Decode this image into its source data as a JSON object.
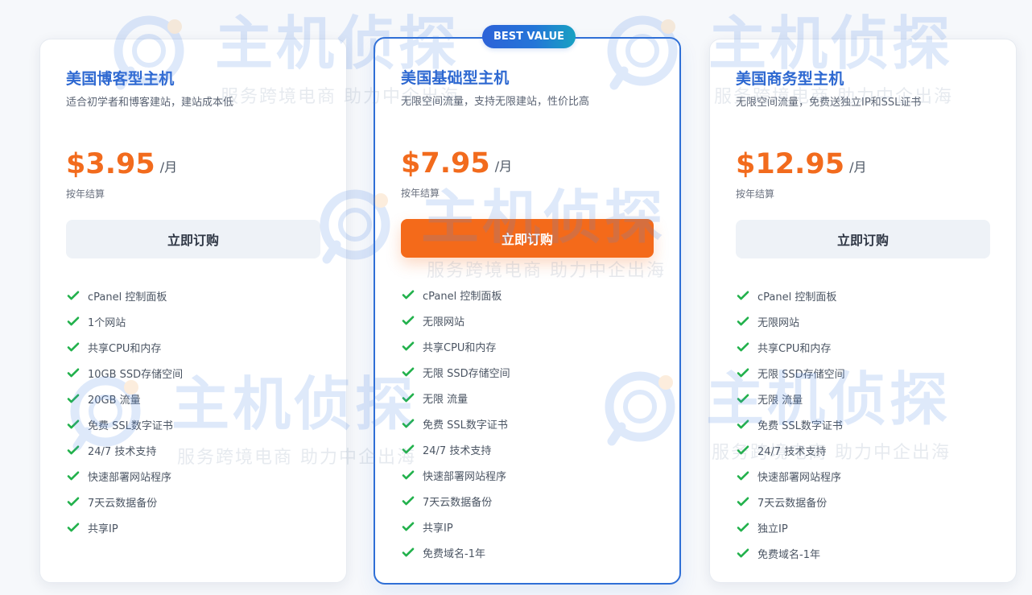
{
  "plans": [
    {
      "title": "美国博客型主机",
      "description": "适合初学者和博客建站，建站成本低",
      "price": "$3.95",
      "period": "/月",
      "billing": "按年结算",
      "button_label": "立即订购",
      "features": [
        "cPanel 控制面板",
        "1个网站",
        "共享CPU和内存",
        "10GB SSD存储空间",
        "20GB 流量",
        "免费 SSL数字证书",
        "24/7 技术支持",
        "快速部署网站程序",
        "7天云数据备份",
        "共享IP"
      ]
    },
    {
      "badge": "BEST VALUE",
      "title": "美国基础型主机",
      "description": "无限空间流量，支持无限建站，性价比高",
      "price": "$7.95",
      "period": "/月",
      "billing": "按年结算",
      "button_label": "立即订购",
      "features": [
        "cPanel 控制面板",
        "无限网站",
        "共享CPU和内存",
        "无限 SSD存储空间",
        "无限 流量",
        "免费 SSL数字证书",
        "24/7 技术支持",
        "快速部署网站程序",
        "7天云数据备份",
        "共享IP",
        "免费域名-1年"
      ]
    },
    {
      "title": "美国商务型主机",
      "description": "无限空间流量，免费送独立IP和SSL证书",
      "price": "$12.95",
      "period": "/月",
      "billing": "按年结算",
      "button_label": "立即订购",
      "features": [
        "cPanel 控制面板",
        "无限网站",
        "共享CPU和内存",
        "无限 SSD存储空间",
        "无限 流量",
        "免费 SSL数字证书",
        "24/7 技术支持",
        "快速部署网站程序",
        "7天云数据备份",
        "独立IP",
        "免费域名-1年"
      ]
    }
  ],
  "watermark": {
    "brand": "主机侦探",
    "slogan": "服务跨境电商 助力中企出海"
  },
  "icons": {
    "check": "check-icon",
    "watermark_logo": "watermark-logo-icon"
  },
  "colors": {
    "title_blue": "#2d68d1",
    "price_orange": "#f26b1d",
    "check_green": "#22b14c",
    "featured_border": "#2f6fd6",
    "button_gray": "#eef2f7",
    "button_orange": "#f46a1a"
  }
}
